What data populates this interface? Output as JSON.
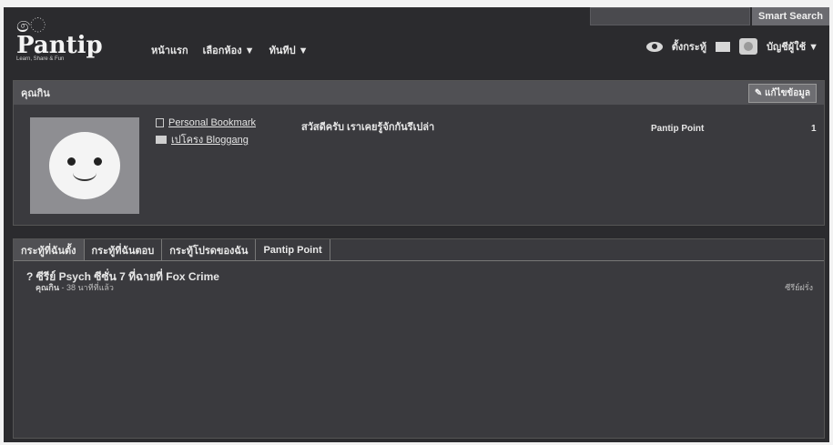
{
  "search": {
    "button_label": "Smart Search",
    "value": ""
  },
  "logo": {
    "mark": "ෙ",
    "name": "Pantip",
    "tagline": "Learn, Share & Fun"
  },
  "nav": {
    "items": [
      "หน้าแรก",
      "เลือกห้อง ▼",
      "ทันทีป ▼"
    ]
  },
  "right_nav": {
    "settings_label": "ตั้งกระทู้",
    "account_label": "บัญชีผู้ใช้ ▼"
  },
  "profile": {
    "name": "คุณกิน",
    "edit_label": "แก้ไขข้อมูล",
    "bookmark_label": "Personal Bookmark",
    "blog_label": "เปโครง Bloggang",
    "greeting": "สวัสดีครับ เราเคยรู้จักกันรึเปล่า",
    "points_label": "Pantip Point",
    "points_value": "1"
  },
  "tabs": [
    "กระทู้ที่ฉันตั้ง",
    "กระทู้ที่ฉันตอบ",
    "กระทู้โปรดของฉัน",
    "Pantip Point"
  ],
  "topics": [
    {
      "title": "? ซีรีย์ Psych ซีซั่น 7 ที่ฉายที่ Fox Crime",
      "author": "คุณกิน",
      "time": " - 38 นาทีที่แล้ว",
      "tag": "ซีรีย์ฝรั่ง"
    }
  ]
}
